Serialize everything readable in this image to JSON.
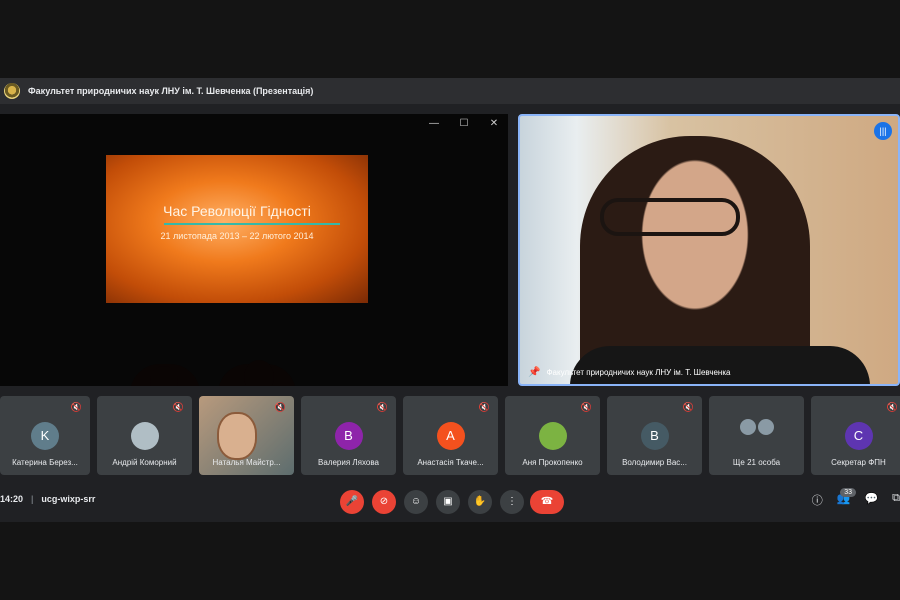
{
  "window": {
    "title": "Факультет природничих наук ЛНУ ім. Т. Шевченка (Презентація)"
  },
  "presentation": {
    "slide_title": "Час Революції Гідності",
    "slide_subtitle": "21 листопада 2013 – 22 лютого 2014",
    "controls": {
      "minimize": "—",
      "maximize": "☐",
      "close": "✕"
    }
  },
  "pinned": {
    "label": "Факультет природничих наук ЛНУ ім. Т. Шевченка"
  },
  "participants": [
    {
      "name": "Катерина Берез...",
      "initial": "K",
      "color": "#607d8b",
      "type": "letter"
    },
    {
      "name": "Андрій Коморний",
      "initial": "",
      "color": "#b0bec5",
      "type": "photo"
    },
    {
      "name": "Наталья Майстр...",
      "initial": "",
      "color": "",
      "type": "video"
    },
    {
      "name": "Валерия Ляхова",
      "initial": "В",
      "color": "#8e24aa",
      "type": "letter"
    },
    {
      "name": "Анастасія Ткаче...",
      "initial": "А",
      "color": "#f4511e",
      "type": "letter"
    },
    {
      "name": "Аня Прокопенко",
      "initial": "",
      "color": "#7cb342",
      "type": "photo"
    },
    {
      "name": "Володимир Вас...",
      "initial": "В",
      "color": "#455a64",
      "type": "letter"
    },
    {
      "name": "Ще 21 особа",
      "initial": "",
      "color": "",
      "type": "more"
    },
    {
      "name": "Секретар ФПН",
      "initial": "С",
      "color": "#5e35b1",
      "type": "letter"
    }
  ],
  "toolbar": {
    "time": "14:20",
    "separator": "|",
    "meeting_code": "ucg-wixp-srr",
    "participant_count": "33",
    "icons": {
      "mic": "mic-off-icon",
      "camera": "camera-off-icon",
      "emoji": "emoji-icon",
      "present": "present-icon",
      "hand": "raise-hand-icon",
      "more": "more-icon",
      "end": "end-call-icon",
      "info": "info-icon",
      "people": "people-icon",
      "chat": "chat-icon",
      "activities": "activities-icon"
    }
  }
}
